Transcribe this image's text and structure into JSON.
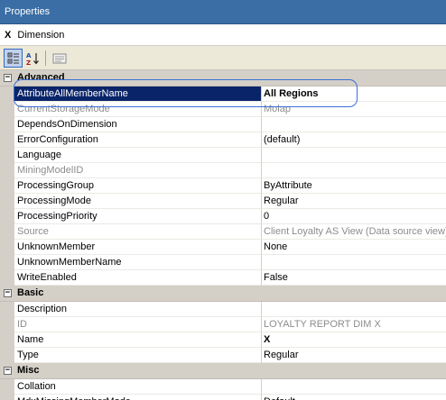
{
  "window": {
    "title": "Properties"
  },
  "object": {
    "marker": "X",
    "label": "Dimension"
  },
  "toolbar": {
    "buttons": [
      {
        "name": "categorized-button",
        "icon": "categorized-icon"
      },
      {
        "name": "alphabetical-button",
        "icon": "sort-alphabetical-icon"
      },
      {
        "name": "property-pages-button",
        "icon": "property-pages-icon"
      }
    ]
  },
  "categories": [
    {
      "label": "Advanced",
      "toggle": "−",
      "properties": [
        {
          "name": "AttributeAllMemberName",
          "value": "All Regions",
          "state": "selected"
        },
        {
          "name": "CurrentStorageMode",
          "value": "Molap",
          "state": "disabled"
        },
        {
          "name": "DependsOnDimension",
          "value": "",
          "state": "normal"
        },
        {
          "name": "ErrorConfiguration",
          "value": "(default)",
          "state": "normal"
        },
        {
          "name": "Language",
          "value": "",
          "state": "normal"
        },
        {
          "name": "MiningModelID",
          "value": "",
          "state": "disabled"
        },
        {
          "name": "ProcessingGroup",
          "value": "ByAttribute",
          "state": "normal"
        },
        {
          "name": "ProcessingMode",
          "value": "Regular",
          "state": "normal"
        },
        {
          "name": "ProcessingPriority",
          "value": "0",
          "state": "normal"
        },
        {
          "name": "Source",
          "value": "Client Loyalty AS View (Data source view)",
          "state": "disabled"
        },
        {
          "name": "UnknownMember",
          "value": "None",
          "state": "normal"
        },
        {
          "name": "UnknownMemberName",
          "value": "",
          "state": "normal"
        },
        {
          "name": "WriteEnabled",
          "value": "False",
          "state": "normal"
        }
      ]
    },
    {
      "label": "Basic",
      "toggle": "−",
      "properties": [
        {
          "name": "Description",
          "value": "",
          "state": "normal"
        },
        {
          "name": "ID",
          "value": "LOYALTY REPORT DIM X",
          "state": "disabled"
        },
        {
          "name": "Name",
          "value": "X",
          "state": "bold"
        },
        {
          "name": "Type",
          "value": "Regular",
          "state": "normal"
        }
      ]
    },
    {
      "label": "Misc",
      "toggle": "−",
      "properties": [
        {
          "name": "Collation",
          "value": "",
          "state": "normal"
        },
        {
          "name": "MdxMissingMemberMode",
          "value": "Default",
          "state": "normal"
        }
      ]
    }
  ],
  "colors": {
    "titlebar": "#3a6ea5",
    "selection": "#0a246a",
    "gridMargin": "#d4d0c8",
    "highlightOutline": "#3c6fd6"
  }
}
